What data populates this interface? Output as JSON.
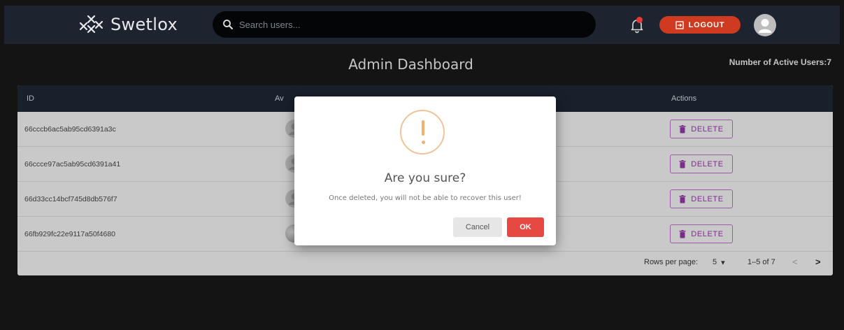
{
  "app": {
    "name": "Swetlox"
  },
  "search": {
    "placeholder": "Search users..."
  },
  "header": {
    "logout_label": "LOGOUT"
  },
  "page": {
    "title": "Admin Dashboard",
    "active_users_label": "Number of Active Users:7"
  },
  "table": {
    "columns": {
      "id": "ID",
      "avatar_partial": "Av",
      "actions": "Actions"
    },
    "rows": [
      {
        "id": "66cccb6ac5ab95cd6391a3c",
        "action": "DELETE"
      },
      {
        "id": "66ccce97ac5ab95cd6391a41",
        "action": "DELETE"
      },
      {
        "id": "66d33cc14bcf745d8db576f7",
        "action": "DELETE"
      },
      {
        "id": "66fb929fc22e9117a50f4680",
        "action": "DELETE"
      }
    ],
    "footer": {
      "rows_per_page_label": "Rows per page:",
      "rows_per_page_value": "5",
      "range": "1–5 of 7"
    }
  },
  "modal": {
    "title": "Are you sure?",
    "text": "Once deleted, you will not be able to recover this user!",
    "cancel_label": "Cancel",
    "ok_label": "OK"
  },
  "colors": {
    "topbar": "#1e2330",
    "logout": "#cf3b20",
    "delete": "#7b2d8b",
    "ok": "#e64942",
    "warning": "#f4ae6f"
  },
  "icons": [
    "swetlox-logo-icon",
    "search-icon",
    "bell-icon",
    "logout-icon",
    "user-avatar-icon",
    "trash-icon",
    "warning-icon",
    "chevron-left-icon",
    "chevron-right-icon",
    "dropdown-arrow-icon"
  ]
}
